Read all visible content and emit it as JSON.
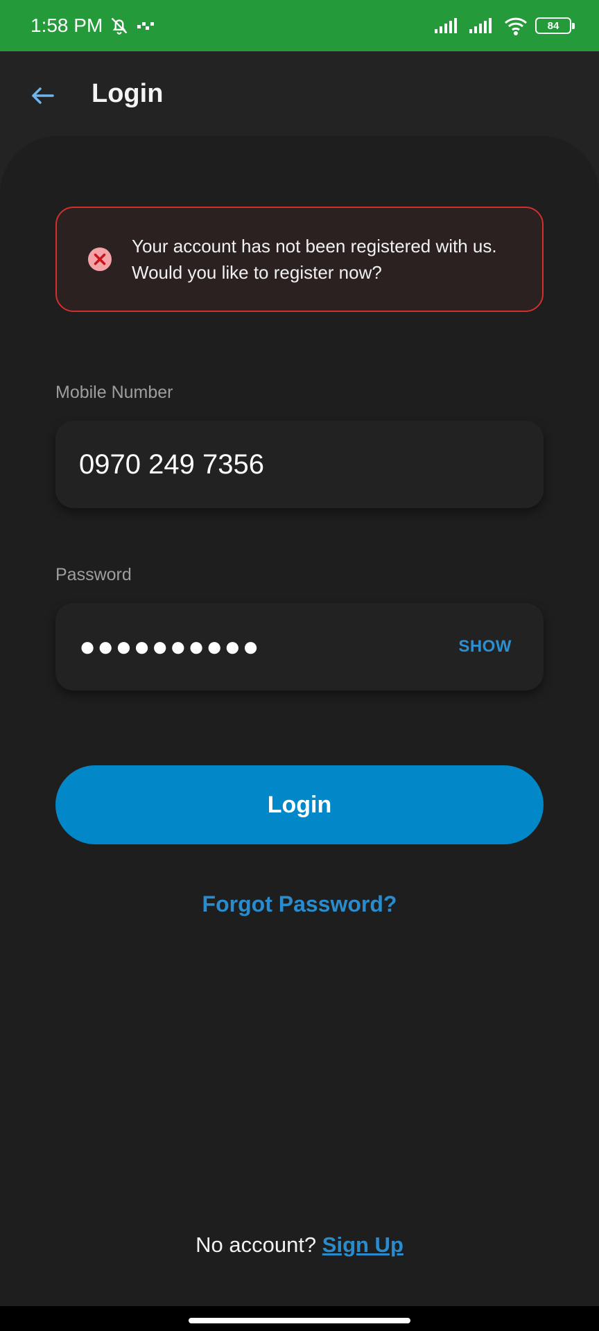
{
  "status_bar": {
    "time": "1:58 PM",
    "battery_level": "84",
    "icons": [
      "bell-off-icon",
      "dots-icon",
      "signal-icon",
      "signal-icon",
      "wifi-icon",
      "battery-icon"
    ]
  },
  "header": {
    "title": "Login",
    "back_icon": "arrow-left-icon"
  },
  "error": {
    "icon": "error-circle-icon",
    "message": "Your account has not been registered with us. Would you like to register now?",
    "border_color": "#d32f2f"
  },
  "form": {
    "mobile_label": "Mobile Number",
    "mobile_value": "0970 249 7356",
    "password_label": "Password",
    "password_masked": "●●●●●●●●●●",
    "show_label": "SHOW",
    "login_label": "Login",
    "forgot_label": "Forgot Password?"
  },
  "footer": {
    "prompt": "No account?",
    "signup_label": "Sign Up"
  },
  "colors": {
    "status_bar": "#259a3b",
    "accent": "#0288c8",
    "link": "#2a8ccd",
    "background": "#1e1e1e"
  }
}
